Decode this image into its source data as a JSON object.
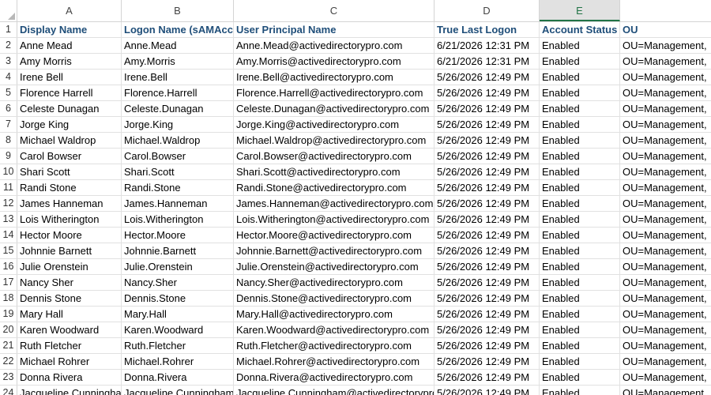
{
  "columns": [
    "A",
    "B",
    "C",
    "D",
    "E"
  ],
  "selected_column": "E",
  "headers": [
    "Display Name",
    "Logon Name (sAMAccountName)",
    "User Principal Name",
    "True Last Logon",
    "Account Status",
    "OU"
  ],
  "rows": [
    [
      "Anne Mead",
      "Anne.Mead",
      "Anne.Mead@activedirectorypro.com",
      "6/21/2026 12:31 PM",
      "Enabled",
      "OU=Management,"
    ],
    [
      "Amy Morris",
      "Amy.Morris",
      "Amy.Morris@activedirectorypro.com",
      "6/21/2026 12:31 PM",
      "Enabled",
      "OU=Management,"
    ],
    [
      "Irene Bell",
      "Irene.Bell",
      "Irene.Bell@activedirectorypro.com",
      "5/26/2026 12:49 PM",
      "Enabled",
      "OU=Management,"
    ],
    [
      "Florence Harrell",
      "Florence.Harrell",
      "Florence.Harrell@activedirectorypro.com",
      "5/26/2026 12:49 PM",
      "Enabled",
      "OU=Management,"
    ],
    [
      "Celeste Dunagan",
      "Celeste.Dunagan",
      "Celeste.Dunagan@activedirectorypro.com",
      "5/26/2026 12:49 PM",
      "Enabled",
      "OU=Management,"
    ],
    [
      "Jorge King",
      "Jorge.King",
      "Jorge.King@activedirectorypro.com",
      "5/26/2026 12:49 PM",
      "Enabled",
      "OU=Management,"
    ],
    [
      "Michael Waldrop",
      "Michael.Waldrop",
      "Michael.Waldrop@activedirectorypro.com",
      "5/26/2026 12:49 PM",
      "Enabled",
      "OU=Management,"
    ],
    [
      "Carol Bowser",
      "Carol.Bowser",
      "Carol.Bowser@activedirectorypro.com",
      "5/26/2026 12:49 PM",
      "Enabled",
      "OU=Management,"
    ],
    [
      "Shari Scott",
      "Shari.Scott",
      "Shari.Scott@activedirectorypro.com",
      "5/26/2026 12:49 PM",
      "Enabled",
      "OU=Management,"
    ],
    [
      "Randi Stone",
      "Randi.Stone",
      "Randi.Stone@activedirectorypro.com",
      "5/26/2026 12:49 PM",
      "Enabled",
      "OU=Management,"
    ],
    [
      "James Hanneman",
      "James.Hanneman",
      "James.Hanneman@activedirectorypro.com",
      "5/26/2026 12:49 PM",
      "Enabled",
      "OU=Management,"
    ],
    [
      "Lois Witherington",
      "Lois.Witherington",
      "Lois.Witherington@activedirectorypro.com",
      "5/26/2026 12:49 PM",
      "Enabled",
      "OU=Management,"
    ],
    [
      "Hector Moore",
      "Hector.Moore",
      "Hector.Moore@activedirectorypro.com",
      "5/26/2026 12:49 PM",
      "Enabled",
      "OU=Management,"
    ],
    [
      "Johnnie Barnett",
      "Johnnie.Barnett",
      "Johnnie.Barnett@activedirectorypro.com",
      "5/26/2026 12:49 PM",
      "Enabled",
      "OU=Management,"
    ],
    [
      "Julie Orenstein",
      "Julie.Orenstein",
      "Julie.Orenstein@activedirectorypro.com",
      "5/26/2026 12:49 PM",
      "Enabled",
      "OU=Management,"
    ],
    [
      "Nancy Sher",
      "Nancy.Sher",
      "Nancy.Sher@activedirectorypro.com",
      "5/26/2026 12:49 PM",
      "Enabled",
      "OU=Management,"
    ],
    [
      "Dennis Stone",
      "Dennis.Stone",
      "Dennis.Stone@activedirectorypro.com",
      "5/26/2026 12:49 PM",
      "Enabled",
      "OU=Management,"
    ],
    [
      "Mary Hall",
      "Mary.Hall",
      "Mary.Hall@activedirectorypro.com",
      "5/26/2026 12:49 PM",
      "Enabled",
      "OU=Management,"
    ],
    [
      "Karen Woodward",
      "Karen.Woodward",
      "Karen.Woodward@activedirectorypro.com",
      "5/26/2026 12:49 PM",
      "Enabled",
      "OU=Management,"
    ],
    [
      "Ruth Fletcher",
      "Ruth.Fletcher",
      "Ruth.Fletcher@activedirectorypro.com",
      "5/26/2026 12:49 PM",
      "Enabled",
      "OU=Management,"
    ],
    [
      "Michael Rohrer",
      "Michael.Rohrer",
      "Michael.Rohrer@activedirectorypro.com",
      "5/26/2026 12:49 PM",
      "Enabled",
      "OU=Management,"
    ],
    [
      "Donna Rivera",
      "Donna.Rivera",
      "Donna.Rivera@activedirectorypro.com",
      "5/26/2026 12:49 PM",
      "Enabled",
      "OU=Management,"
    ],
    [
      "Jacqueline Cunningham",
      "Jacqueline.Cunningham",
      "Jacqueline.Cunningham@activedirectorypro.com",
      "5/26/2026 12:49 PM",
      "Enabled",
      "OU=Management,"
    ]
  ]
}
